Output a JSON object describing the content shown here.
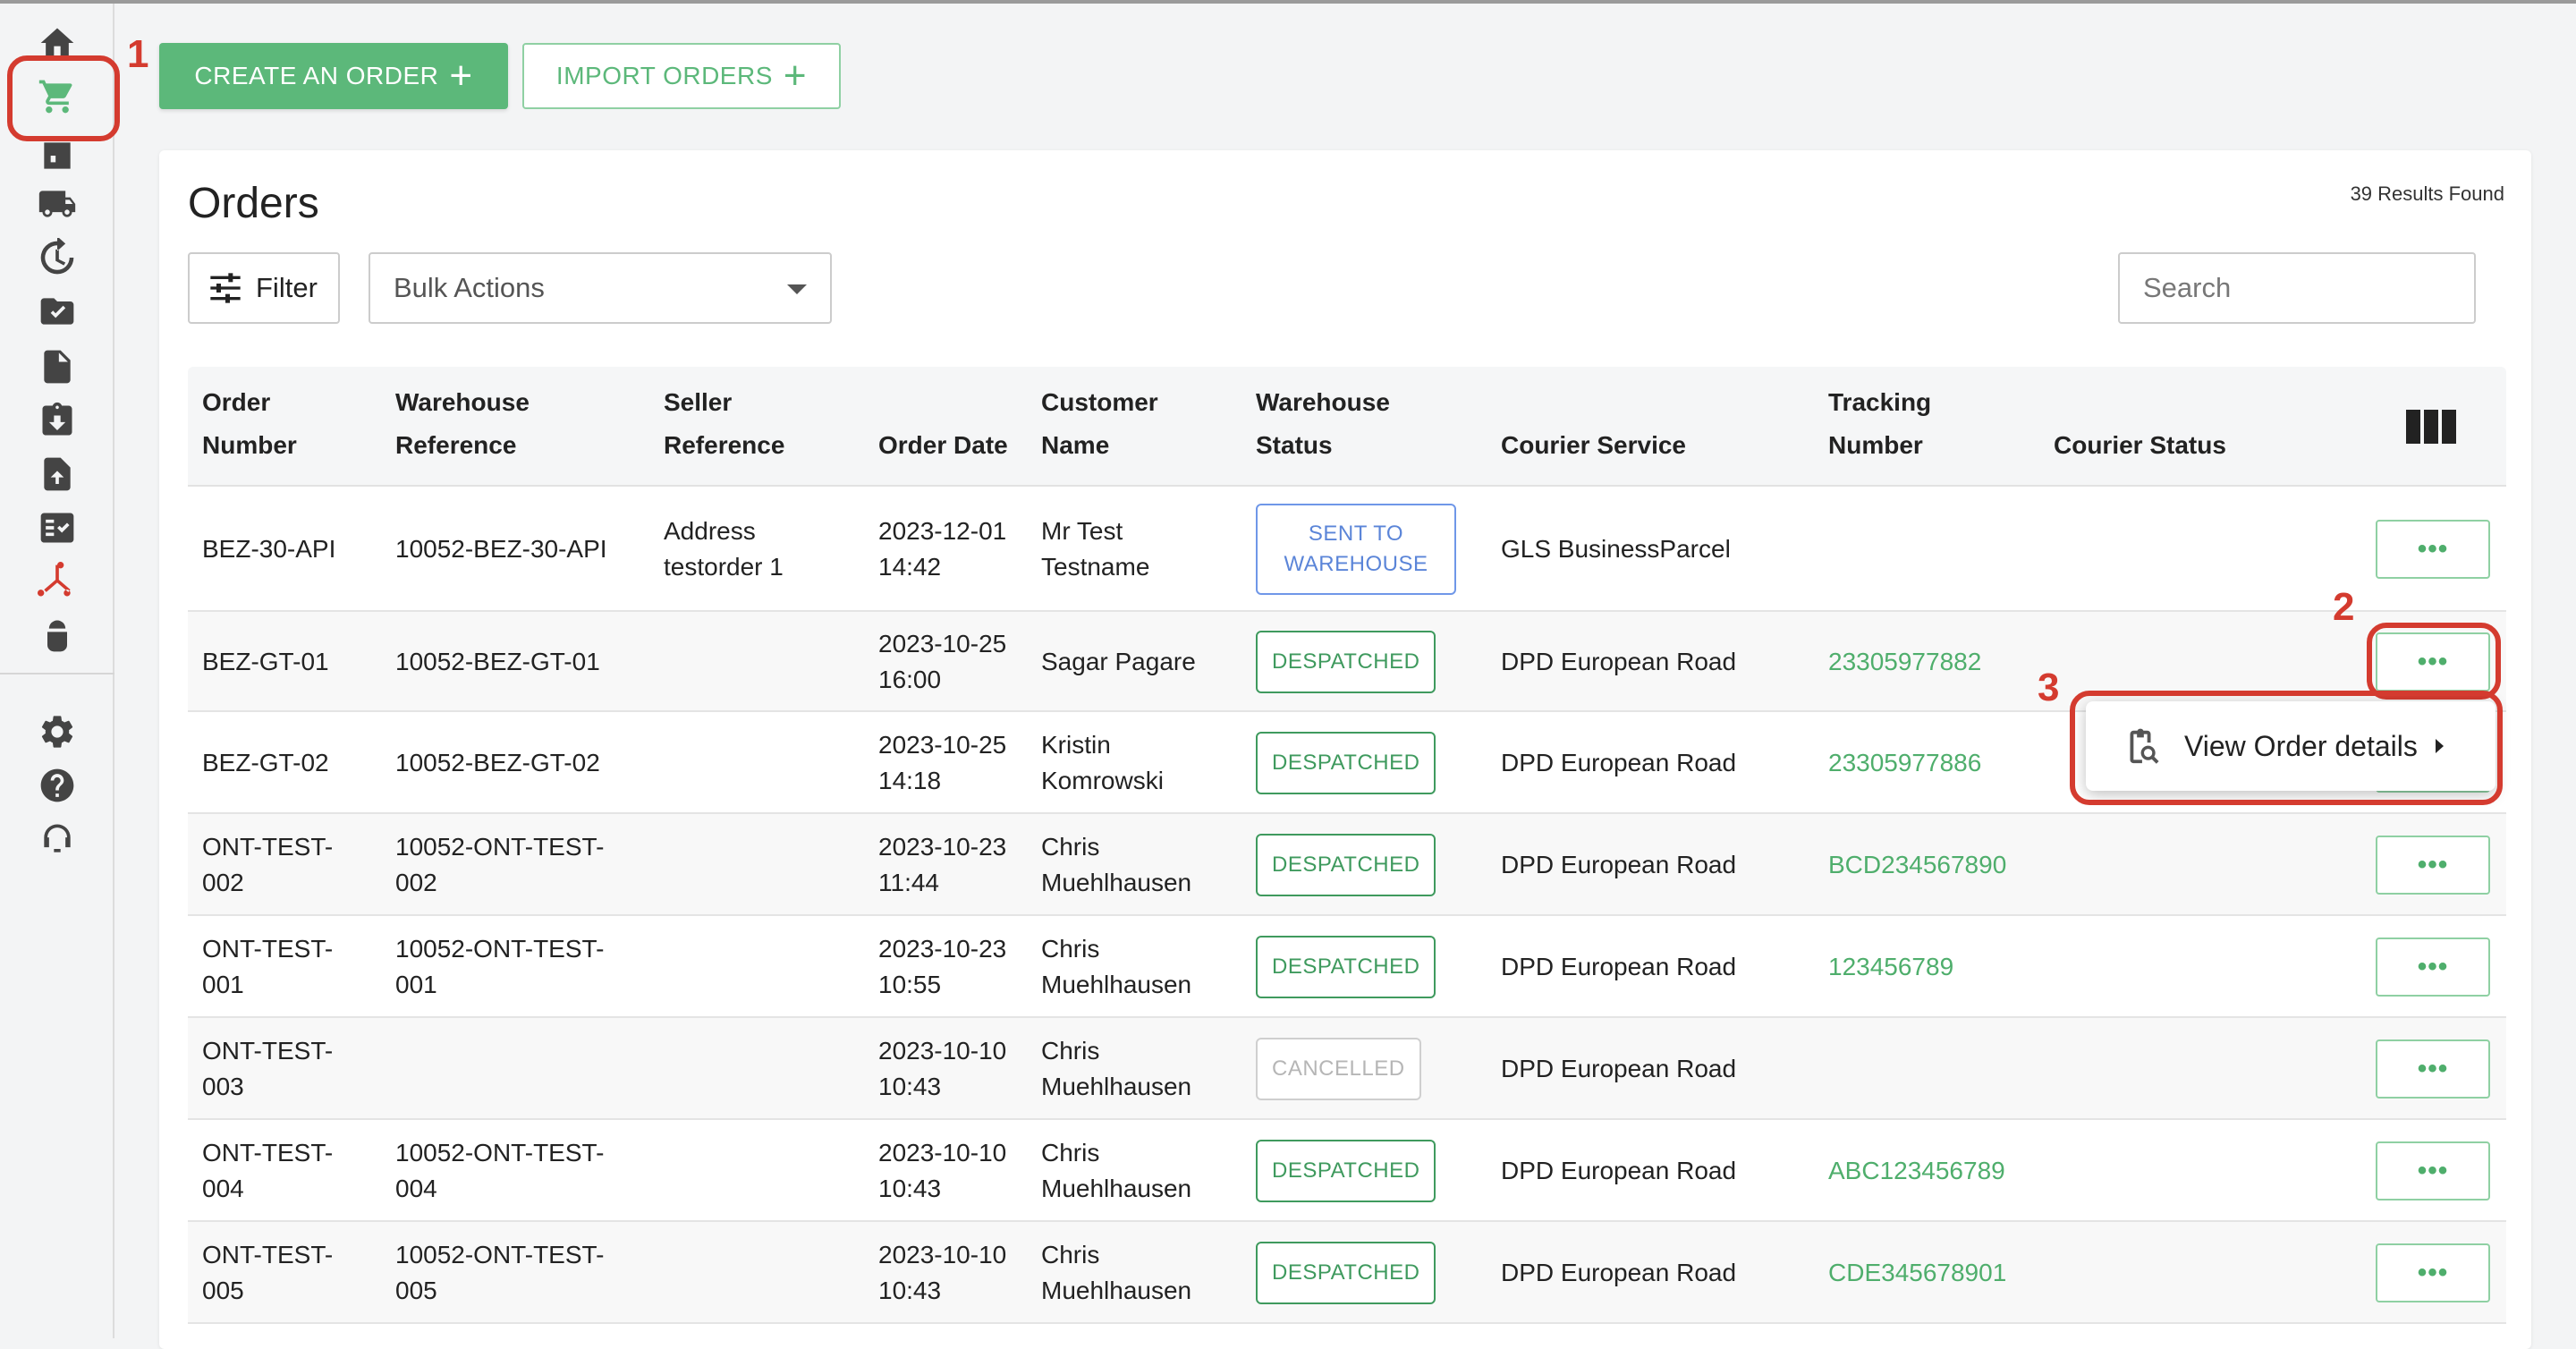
{
  "toolbar": {
    "create_label": "CREATE AN ORDER",
    "import_label": "IMPORT ORDERS"
  },
  "page": {
    "title": "Orders",
    "results": "39 Results Found"
  },
  "controls": {
    "filter_label": "Filter",
    "bulk_actions_label": "Bulk Actions",
    "search_placeholder": "Search"
  },
  "table": {
    "headers": {
      "order_number": [
        "Order",
        "Number"
      ],
      "warehouse_reference": [
        "Warehouse",
        "Reference"
      ],
      "seller_reference": [
        "Seller",
        "Reference"
      ],
      "order_date": [
        "",
        "Order Date"
      ],
      "customer_name": [
        "Customer",
        "Name"
      ],
      "warehouse_status": [
        "Warehouse",
        "Status"
      ],
      "courier_service": [
        "",
        "Courier Service"
      ],
      "tracking_number": [
        "Tracking",
        "Number"
      ],
      "courier_status": [
        "",
        "Courier Status"
      ]
    },
    "rows": [
      {
        "order": [
          "BEZ-30-API"
        ],
        "wref": [
          "10052-BEZ-30-API"
        ],
        "sref": [
          "Address",
          "testorder 1"
        ],
        "date": [
          "2023-12-01",
          "14:42"
        ],
        "customer": [
          "Mr Test",
          "Testname"
        ],
        "status": [
          "SENT TO",
          "WAREHOUSE"
        ],
        "courier": "GLS BusinessParcel",
        "tracking": "",
        "more": "•••"
      },
      {
        "order": [
          "BEZ-GT-01"
        ],
        "wref": [
          "10052-BEZ-GT-01"
        ],
        "sref": [],
        "date": [
          "2023-10-25",
          "16:00"
        ],
        "customer": [
          "Sagar Pagare"
        ],
        "status": [
          "DESPATCHED"
        ],
        "courier": "DPD European Road",
        "tracking": "23305977882",
        "more": "•••"
      },
      {
        "order": [
          "BEZ-GT-02"
        ],
        "wref": [
          "10052-BEZ-GT-02"
        ],
        "sref": [],
        "date": [
          "2023-10-25",
          "14:18"
        ],
        "customer": [
          "Kristin",
          "Komrowski"
        ],
        "status": [
          "DESPATCHED"
        ],
        "courier": "DPD European Road",
        "tracking": "23305977886",
        "more": "•••"
      },
      {
        "order": [
          "ONT-TEST-",
          "002"
        ],
        "wref": [
          "10052-ONT-TEST-",
          "002"
        ],
        "sref": [],
        "date": [
          "2023-10-23",
          "11:44"
        ],
        "customer": [
          "Chris",
          "Muehlhausen"
        ],
        "status": [
          "DESPATCHED"
        ],
        "courier": "DPD European Road",
        "tracking": "BCD234567890",
        "more": "•••"
      },
      {
        "order": [
          "ONT-TEST-",
          "001"
        ],
        "wref": [
          "10052-ONT-TEST-",
          "001"
        ],
        "sref": [],
        "date": [
          "2023-10-23",
          "10:55"
        ],
        "customer": [
          "Chris",
          "Muehlhausen"
        ],
        "status": [
          "DESPATCHED"
        ],
        "courier": "DPD European Road",
        "tracking": "123456789",
        "more": "•••"
      },
      {
        "order": [
          "ONT-TEST-",
          "003"
        ],
        "wref": [],
        "sref": [],
        "date": [
          "2023-10-10",
          "10:43"
        ],
        "customer": [
          "Chris",
          "Muehlhausen"
        ],
        "status": [
          "CANCELLED"
        ],
        "courier": "DPD European Road",
        "tracking": "",
        "more": "•••"
      },
      {
        "order": [
          "ONT-TEST-",
          "004"
        ],
        "wref": [
          "10052-ONT-TEST-",
          "004"
        ],
        "sref": [],
        "date": [
          "2023-10-10",
          "10:43"
        ],
        "customer": [
          "Chris",
          "Muehlhausen"
        ],
        "status": [
          "DESPATCHED"
        ],
        "courier": "DPD European Road",
        "tracking": "ABC123456789",
        "more": "•••"
      },
      {
        "order": [
          "ONT-TEST-",
          "005"
        ],
        "wref": [
          "10052-ONT-TEST-",
          "005"
        ],
        "sref": [],
        "date": [
          "2023-10-10",
          "10:43"
        ],
        "customer": [
          "Chris",
          "Muehlhausen"
        ],
        "status": [
          "DESPATCHED"
        ],
        "courier": "DPD European Road",
        "tracking": "CDE345678901",
        "more": "•••"
      }
    ]
  },
  "dropdown": {
    "view_details_label": "View Order details"
  },
  "annotations": [
    "1",
    "2",
    "3"
  ],
  "colors": {
    "accent": "#5cb87a",
    "annotation": "#d43b2f",
    "status_despatched": "#3f9a5e",
    "status_sent": "#5b85d8",
    "status_cancelled": "#b6b6b6"
  },
  "icons": {
    "sidebar": [
      "home-icon",
      "cart-icon",
      "warehouse-icon",
      "truck-icon",
      "returns-icon",
      "folder-check-icon",
      "document-icon",
      "download-icon",
      "upload-icon",
      "checklist-icon",
      "integration-icon",
      "android-icon",
      "gear-icon",
      "help-icon",
      "support-icon"
    ]
  }
}
